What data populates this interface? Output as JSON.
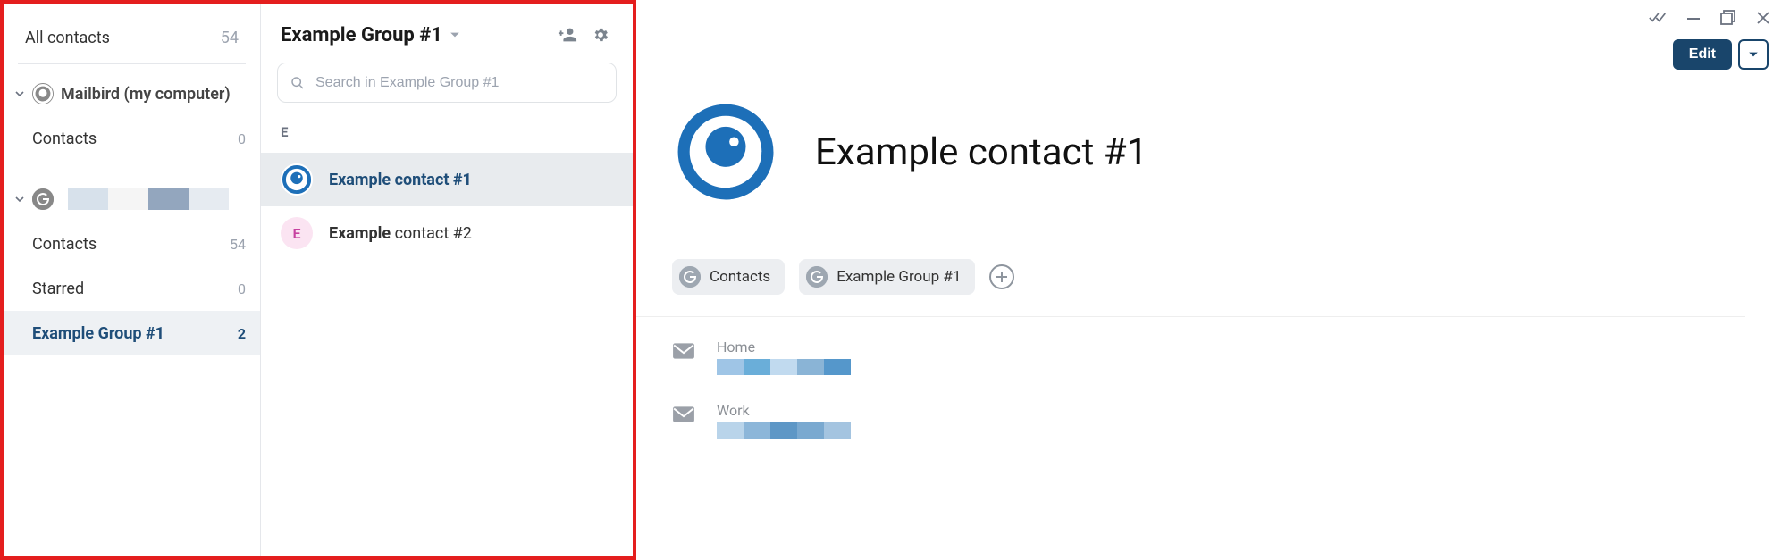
{
  "sidebar": {
    "all_contacts_label": "All contacts",
    "all_contacts_count": "54",
    "accounts": [
      {
        "name": "Mailbird (my computer)",
        "items": [
          {
            "label": "Contacts",
            "count": "0"
          }
        ]
      },
      {
        "name": "",
        "items": [
          {
            "label": "Contacts",
            "count": "54"
          },
          {
            "label": "Starred",
            "count": "0"
          },
          {
            "label": "Example Group #1",
            "count": "2",
            "selected": true
          }
        ]
      }
    ]
  },
  "group": {
    "title": "Example Group #1",
    "search_placeholder": "Search in Example Group #1",
    "section_letter": "E",
    "contacts": [
      {
        "bold": "Example contact #1",
        "rest": "",
        "selected": true,
        "avatar": "mailbird"
      },
      {
        "bold": "Example",
        "rest": " contact #2",
        "selected": false,
        "avatar_letter": "E"
      }
    ]
  },
  "detail": {
    "name": "Example contact #1",
    "edit_label": "Edit",
    "tags": [
      {
        "label": "Contacts"
      },
      {
        "label": "Example Group #1"
      }
    ],
    "emails": [
      {
        "label": "Home"
      },
      {
        "label": "Work"
      }
    ]
  }
}
